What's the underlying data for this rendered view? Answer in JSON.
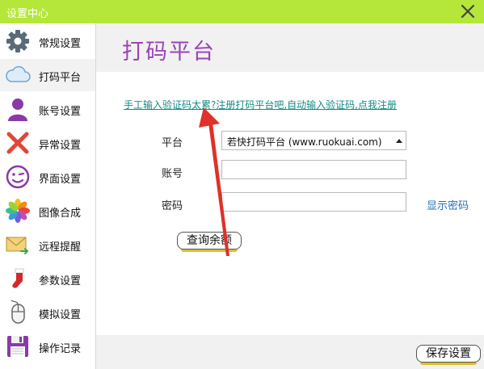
{
  "window": {
    "title": "设置中心"
  },
  "sidebar": {
    "items": [
      {
        "label": "常规设置",
        "icon": "gear-icon"
      },
      {
        "label": "打码平台",
        "icon": "cloud-icon"
      },
      {
        "label": "账号设置",
        "icon": "user-icon"
      },
      {
        "label": "异常设置",
        "icon": "red-x-icon"
      },
      {
        "label": "界面设置",
        "icon": "smiley-icon"
      },
      {
        "label": "图像合成",
        "icon": "photos-icon"
      },
      {
        "label": "远程提醒",
        "icon": "envelope-icon"
      },
      {
        "label": "参数设置",
        "icon": "stocking-icon"
      },
      {
        "label": "模拟设置",
        "icon": "mouse-icon"
      },
      {
        "label": "操作记录",
        "icon": "floppy-disk-icon"
      }
    ],
    "active_index": 1
  },
  "page": {
    "title": "打码平台",
    "promo_link": "手工输入验证码太累?注册打码平台吧,自动输入验证码,点我注册",
    "platform_label": "平台",
    "platform_value": "若快打码平台  (www.ruokuai.com)",
    "account_label": "账号",
    "account_value": "",
    "password_label": "密码",
    "password_value": "",
    "show_password": "显示密码",
    "query_balance_button": "查询余额",
    "save_button": "保存设置"
  },
  "colors": {
    "titlebar": "#b5e63a",
    "page_title": "#9a44b8",
    "link": "#148a86",
    "annotation_arrow": "#e0302a"
  }
}
